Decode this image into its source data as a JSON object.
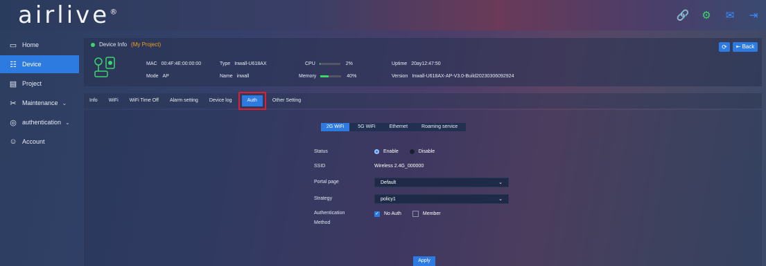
{
  "app": {
    "logo": "airlive",
    "logo_mark": "®"
  },
  "topbar_icons": [
    "link-icon",
    "settings-gear-icon",
    "mail-icon",
    "logout-icon"
  ],
  "sidebar": {
    "items": [
      {
        "label": "Home",
        "icon": "home-icon"
      },
      {
        "label": "Device",
        "icon": "device-icon",
        "active": true
      },
      {
        "label": "Project",
        "icon": "project-icon"
      },
      {
        "label": "Maintenance",
        "icon": "maintenance-icon",
        "has_children": true
      },
      {
        "label": "authentication",
        "icon": "shield-icon",
        "has_children": true
      },
      {
        "label": "Account",
        "icon": "user-icon"
      }
    ]
  },
  "device_info": {
    "title": "Device Info",
    "project": "(My Project)",
    "mac_label": "MAC",
    "mac": "00:4F:4E:00:00:00",
    "mode_label": "Mode",
    "mode": "AP",
    "type_label": "Type",
    "type": "Inwall-U618AX",
    "name_label": "Name",
    "name": "inwall",
    "cpu_label": "CPU",
    "cpu": "2%",
    "cpu_fraction": 0.02,
    "memory_label": "Memory",
    "memory": "40%",
    "memory_fraction": 0.4,
    "uptime_label": "Uptime",
    "uptime": "20ay12:47:50",
    "version_label": "Version",
    "version": "Inwall-U618AX-AP-V3.0-Build20230306092924",
    "back_label": "Back"
  },
  "tabs": [
    "Info",
    "WiFi",
    "WiFi Time Off",
    "Alarm setting",
    "Device log",
    "Auth",
    "Other Setting"
  ],
  "active_tab": "Auth",
  "subtabs": [
    "2G WiFi",
    "5G WiFi",
    "Ethernet",
    "Roaming service"
  ],
  "active_subtab": "2G WiFi",
  "form": {
    "status_label": "Status",
    "status_enable": "Enable",
    "status_disable": "Disable",
    "ssid_label": "SSID",
    "ssid": "Wireless 2.4G_000000",
    "portal_label": "Portal page",
    "portal_value": "Default",
    "strategy_label": "Strategy",
    "strategy_value": "policy1",
    "auth_label_line1": "Authentication",
    "auth_label_line2": "Method",
    "auth_noauth": "No Auth",
    "auth_member": "Member",
    "apply_label": "Apply"
  },
  "colors": {
    "accent": "#2d7ae0",
    "online": "#3ed66a",
    "project": "#f0a020",
    "highlight": "#e02030"
  }
}
